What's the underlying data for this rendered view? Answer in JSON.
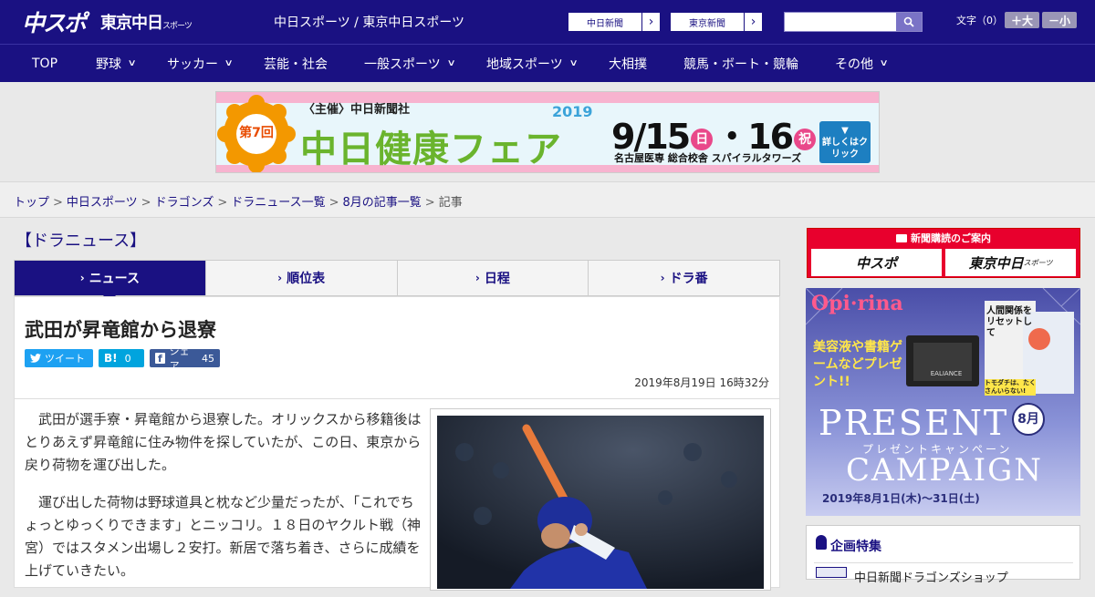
{
  "header": {
    "logo_main": "中スポ",
    "logo_tokyo": "東京中日",
    "logo_tokyo_small": "スポーツ",
    "title": "中日スポーツ / 東京中日スポーツ",
    "site_buttons": [
      {
        "label": "中日新聞"
      },
      {
        "label": "東京新聞"
      }
    ],
    "search_placeholder": "",
    "font_size_label": "文字（0）",
    "font_up": "＋大",
    "font_down": "－小"
  },
  "nav": {
    "items": [
      {
        "label": "TOP",
        "has_dropdown": false
      },
      {
        "label": "野球",
        "has_dropdown": true
      },
      {
        "label": "サッカー",
        "has_dropdown": true
      },
      {
        "label": "芸能・社会",
        "has_dropdown": false
      },
      {
        "label": "一般スポーツ",
        "has_dropdown": true
      },
      {
        "label": "地域スポーツ",
        "has_dropdown": true
      },
      {
        "label": "大相撲",
        "has_dropdown": false
      },
      {
        "label": "競馬・ボート・競輪",
        "has_dropdown": false
      },
      {
        "label": "その他",
        "has_dropdown": true
      }
    ]
  },
  "banner": {
    "organizer": "〈主催〉中日新聞社",
    "edition": "第7回",
    "event_name": "中日健康フェア",
    "year": "2019",
    "dates": "9/15",
    "day1": "日",
    "dates2": "・16",
    "day2": "祝",
    "venue": "名古屋医専 総合校舎 スパイラルタワーズ",
    "cta": "詳しくはクリック"
  },
  "breadcrumb": {
    "items": [
      "トップ",
      "中日スポーツ",
      "ドラゴンズ",
      "ドラニュース一覧",
      "8月の記事一覧"
    ],
    "current": "記事"
  },
  "section_title": "【ドラニュース】",
  "tabs": [
    {
      "label": "ニュース",
      "active": true
    },
    {
      "label": "順位表",
      "active": false
    },
    {
      "label": "日程",
      "active": false
    },
    {
      "label": "ドラ番",
      "active": false
    }
  ],
  "article": {
    "headline": "武田が昇竜館から退寮",
    "share": {
      "tweet": "ツイート",
      "hatena_count": "0",
      "facebook_label": "シェア",
      "facebook_count": "45"
    },
    "date": "2019年8月19日 16時32分",
    "paragraphs": [
      "武田が選手寮・昇竜館から退寮した。オリックスから移籍後はとりあえず昇竜館に住み物件を探していたが、この日、東京から戻り荷物を運び出した。",
      "運び出した荷物は野球道具と枕など少量だったが、「これでちょっとゆっくりできます」とニッコリ。１８日のヤクルト戦（神宮）ではスタメン出場し２安打。新居で落ち着き、さらに成績を上げていきたい。"
    ]
  },
  "right": {
    "subscribe_title": "新聞購読のご案内",
    "subscribe_a": "中スポ",
    "subscribe_b": "東京中日",
    "subscribe_b_small": "スポーツ",
    "campaign": {
      "brand": "Opi·rina",
      "gift_text": "美容液や書籍ゲームなどプレゼント!!",
      "book_text": "人間関係をリセットして",
      "book_text2": "トモダチは、たくさんいらない!",
      "cosme": "EALIANCE",
      "title1": "PRESENT",
      "title2": "CAMPAIGN",
      "month": "8月",
      "subtitle": "プレゼントキャンペーン",
      "period": "2019年8月1日(木)～31日(土)"
    },
    "feature_title": "企画特集",
    "feature_item": "中日新聞ドラゴンズショップ"
  },
  "colors": {
    "brand_navy": "#1a1182",
    "banner_orange": "#f39800",
    "banner_green": "#6ab42d",
    "banner_pink": "#e9488a",
    "subscribe_red": "#e8002d",
    "twitter": "#1da1f2",
    "hatena": "#00a4de",
    "facebook": "#3b5998"
  }
}
